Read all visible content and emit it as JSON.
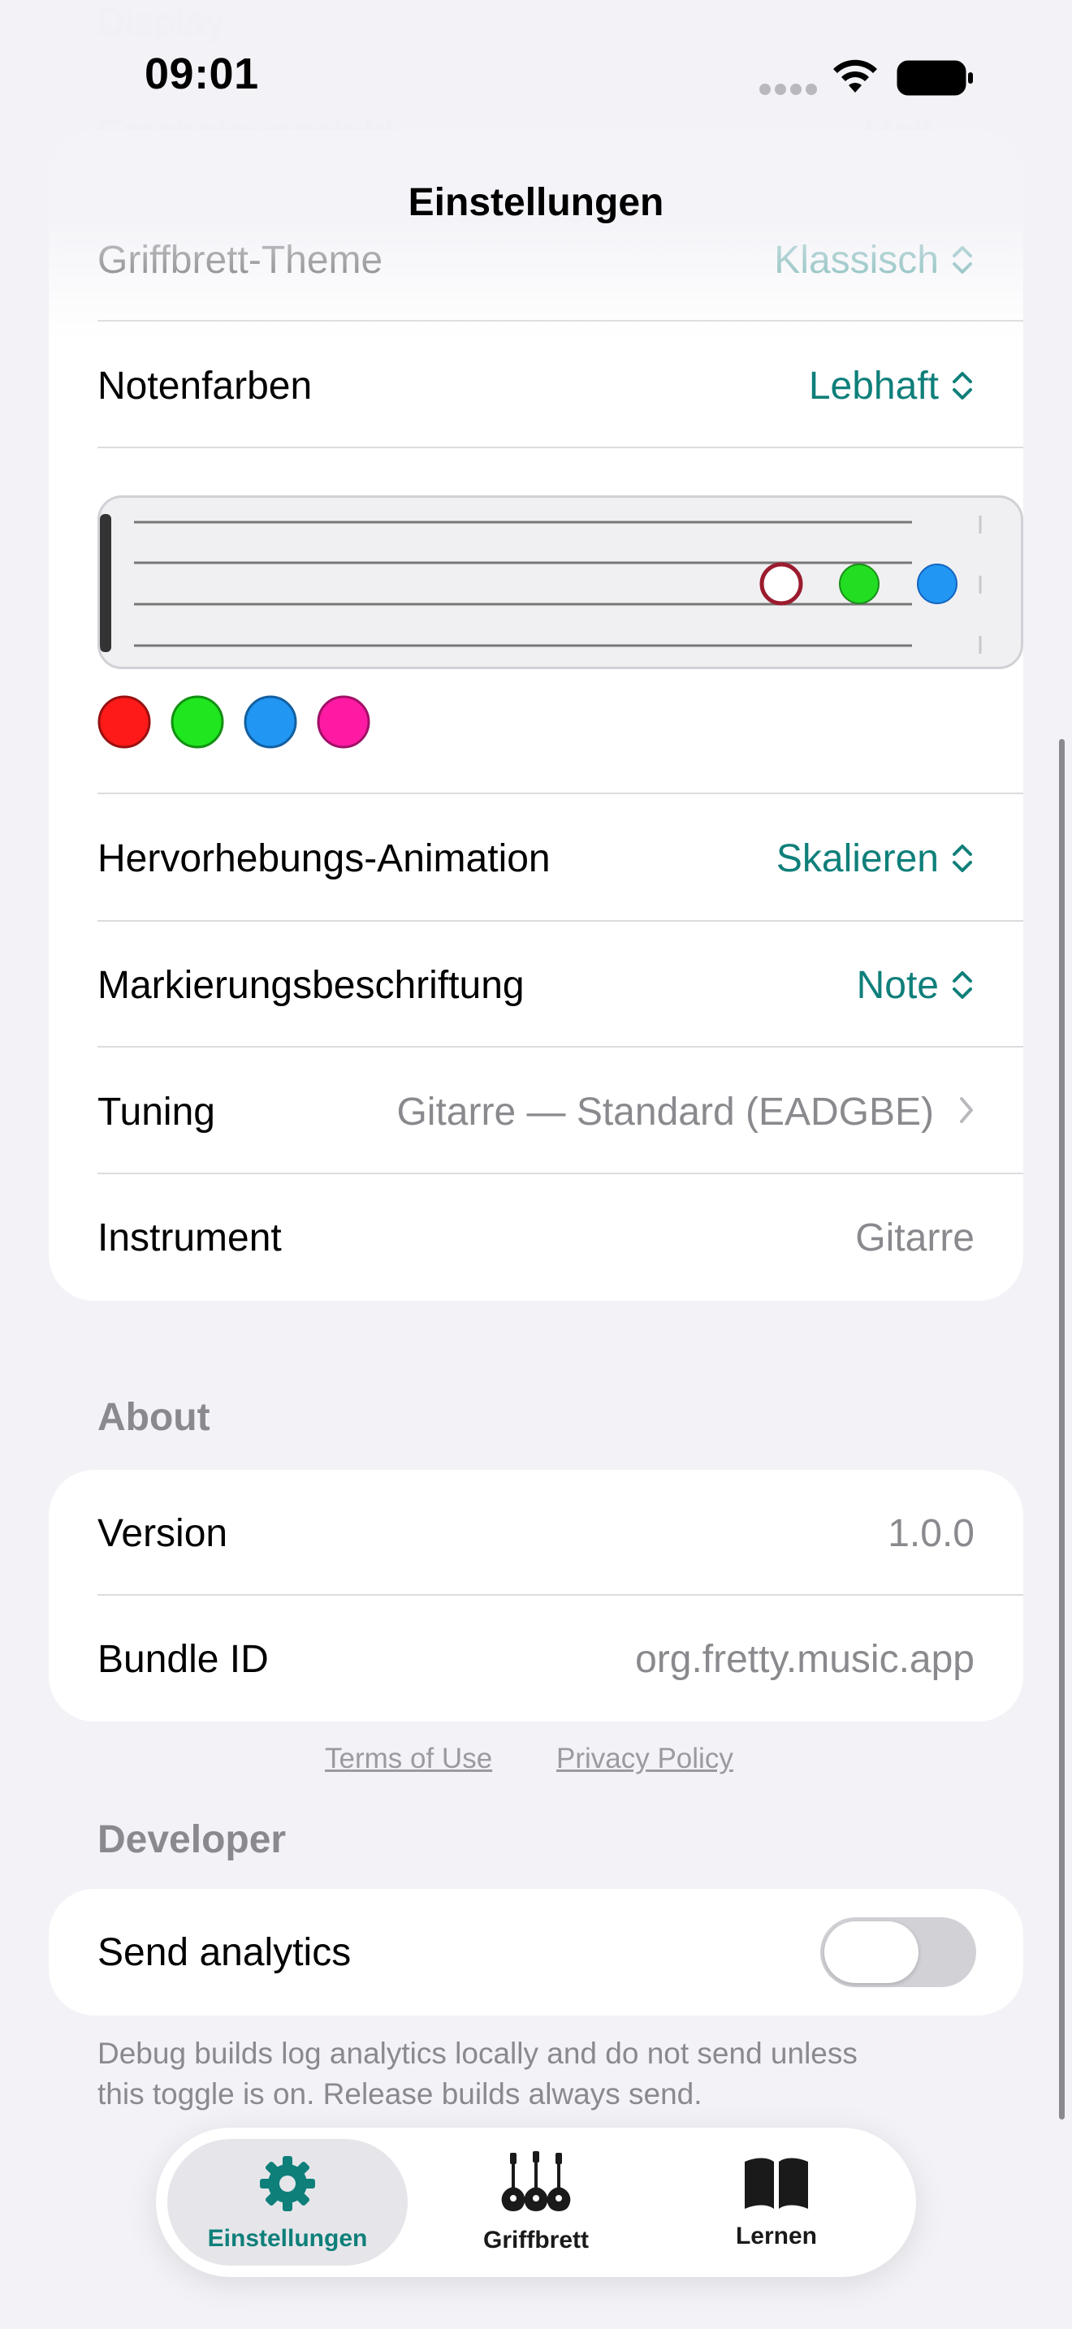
{
  "status_bar": {
    "time": "09:01"
  },
  "header": {
    "title": "Einstellungen",
    "faded_section": "Display",
    "faded_row_label": "Erscheinungsbild",
    "faded_row_value": "Hell"
  },
  "display_card": {
    "rows": [
      {
        "label": "Griffbrett-Theme",
        "value": "Klassisch"
      },
      {
        "label": "Notenfarben",
        "value": "Lebhaft"
      },
      {
        "label": "Hervorhebungs-Animation",
        "value": "Skalieren"
      },
      {
        "label": "Markierungsbeschriftung",
        "value": "Note"
      },
      {
        "label": "Tuning",
        "value": "Gitarre — Standard (EADGBE)"
      },
      {
        "label": "Instrument",
        "value": "Gitarre"
      }
    ],
    "preview_note_colors": [
      "#9b1c2e",
      "#22dd22",
      "#2196f3"
    ],
    "swatches": [
      "#ff1a1a",
      "#1fe61f",
      "#2196f3",
      "#ff1aa3"
    ]
  },
  "about": {
    "heading": "About",
    "rows": [
      {
        "label": "Version",
        "value": "1.0.0"
      },
      {
        "label": "Bundle ID",
        "value": "org.fretty.music.app"
      }
    ]
  },
  "links": {
    "terms": "Terms of Use",
    "privacy": "Privacy Policy"
  },
  "developer": {
    "heading": "Developer",
    "toggle_label": "Send analytics",
    "toggle_on": false,
    "footnote_line1": "Debug builds log analytics locally and do not send unless",
    "footnote_line2": "this toggle is on. Release builds always send."
  },
  "tabbar": {
    "tabs": [
      {
        "label": "Einstellungen",
        "icon": "gear-icon",
        "selected": true
      },
      {
        "label": "Griffbrett",
        "icon": "guitars-icon",
        "selected": false
      },
      {
        "label": "Lernen",
        "icon": "book-icon",
        "selected": false
      }
    ]
  },
  "colors": {
    "accent": "#0f7f7a",
    "secondary_text": "#8a8a8e",
    "background": "#f2f2f7"
  }
}
